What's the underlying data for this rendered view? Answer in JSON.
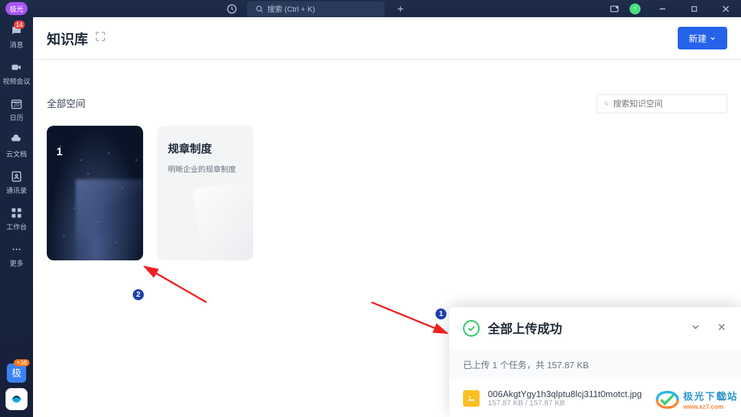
{
  "titlebar": {
    "brand": "极光",
    "search_placeholder": "搜索 (Ctrl + K)"
  },
  "sidebar": {
    "items": [
      {
        "label": "消息",
        "badge": "14"
      },
      {
        "label": "视频会议"
      },
      {
        "label": "日历",
        "date": "20"
      },
      {
        "label": "云文档"
      },
      {
        "label": "通讯录"
      },
      {
        "label": "工作台"
      },
      {
        "label": "更多"
      }
    ],
    "bottom": {
      "badge": "+38",
      "avatar_text": "极"
    }
  },
  "header": {
    "title": "知识库",
    "new_button": "新建"
  },
  "section": {
    "title": "全部空间",
    "search_placeholder": "搜索知识空间"
  },
  "cards": [
    {
      "number": "1"
    },
    {
      "title": "规章制度",
      "desc": "明晰企业的规章制度"
    }
  ],
  "upload": {
    "title": "全部上传成功",
    "summary": "已上传 1 个任务，共 157.87 KB",
    "items": [
      {
        "name": "006AkgtYgy1h3qlptu8lcj311t0motct.jpg",
        "size": "157.87 KB / 157.87 KB"
      }
    ]
  },
  "anno": {
    "n1": "1",
    "n2": "2"
  },
  "watermark": {
    "cn": "极光下载站",
    "en": "www.xz7.com"
  }
}
